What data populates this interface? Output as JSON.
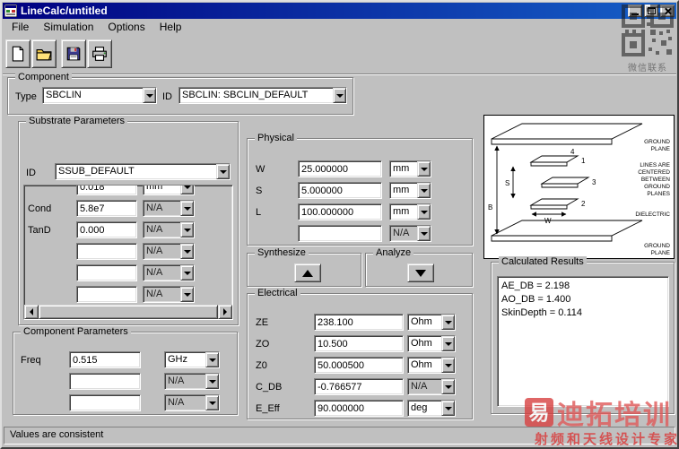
{
  "window": {
    "title": "LineCalc/untitled",
    "menu": [
      "File",
      "Simulation",
      "Options",
      "Help"
    ],
    "status": "Values are consistent"
  },
  "icons": {
    "toolbar": [
      "new-document",
      "open-folder",
      "save-floppy",
      "print"
    ],
    "window_buttons": [
      "minimize",
      "maximize",
      "close"
    ]
  },
  "component": {
    "title": "Component",
    "type_label": "Type",
    "type_value": "SBCLIN",
    "id_label": "ID",
    "id_value": "SBCLIN: SBCLIN_DEFAULT"
  },
  "substrate": {
    "title": "Substrate Parameters",
    "id_label": "ID",
    "id_value": "SSUB_DEFAULT",
    "rows": [
      {
        "label": "",
        "value": "0.018",
        "unit": "mm"
      },
      {
        "label": "Cond",
        "value": "5.8e7",
        "unit": "N/A"
      },
      {
        "label": "TanD",
        "value": "0.000",
        "unit": "N/A"
      },
      {
        "label": "",
        "value": "",
        "unit": "N/A"
      },
      {
        "label": "",
        "value": "",
        "unit": "N/A"
      },
      {
        "label": "",
        "value": "",
        "unit": "N/A"
      }
    ]
  },
  "params": {
    "title": "Component Parameters",
    "rows": [
      {
        "label": "Freq",
        "value": "0.515",
        "unit": "GHz"
      },
      {
        "label": "",
        "value": "",
        "unit": "N/A"
      },
      {
        "label": "",
        "value": "",
        "unit": "N/A"
      }
    ]
  },
  "physical": {
    "title": "Physical",
    "rows": [
      {
        "label": "W",
        "value": "25.000000",
        "unit": "mm"
      },
      {
        "label": "S",
        "value": "5.000000",
        "unit": "mm"
      },
      {
        "label": "L",
        "value": "100.000000",
        "unit": "mm"
      },
      {
        "label": "",
        "value": "",
        "unit": "N/A"
      }
    ]
  },
  "synthesize": {
    "title": "Synthesize"
  },
  "analyze": {
    "title": "Analyze"
  },
  "electrical": {
    "title": "Electrical",
    "rows": [
      {
        "label": "ZE",
        "value": "238.100",
        "unit": "Ohm"
      },
      {
        "label": "ZO",
        "value": "10.500",
        "unit": "Ohm"
      },
      {
        "label": "Z0",
        "value": "50.000500",
        "unit": "Ohm"
      },
      {
        "label": "C_DB",
        "value": "-0.766577",
        "unit": "N/A"
      },
      {
        "label": "E_Eff",
        "value": "90.000000",
        "unit": "deg"
      }
    ]
  },
  "results": {
    "title": "Calculated Results",
    "lines": [
      "AE_DB = 2.198",
      "AO_DB = 1.400",
      "SkinDepth = 0.114"
    ]
  },
  "diagram": {
    "top_label_lines": [
      "GROUND",
      "PLANE"
    ],
    "note_lines": [
      "LINES ARE",
      "CENTERED",
      "BETWEEN",
      "GROUND",
      "PLANES"
    ],
    "dielectric_label": "DIELECTRIC",
    "bottom_label_lines": [
      "GROUND",
      "PLANE"
    ],
    "port_numbers": [
      "4",
      "1",
      "3",
      "2"
    ],
    "dims": [
      "S",
      "B",
      "W"
    ]
  },
  "watermark": {
    "caption": "微信联系",
    "logo_char": "易",
    "brand": "迪拓培训",
    "tagline": "射频和天线设计专家"
  }
}
